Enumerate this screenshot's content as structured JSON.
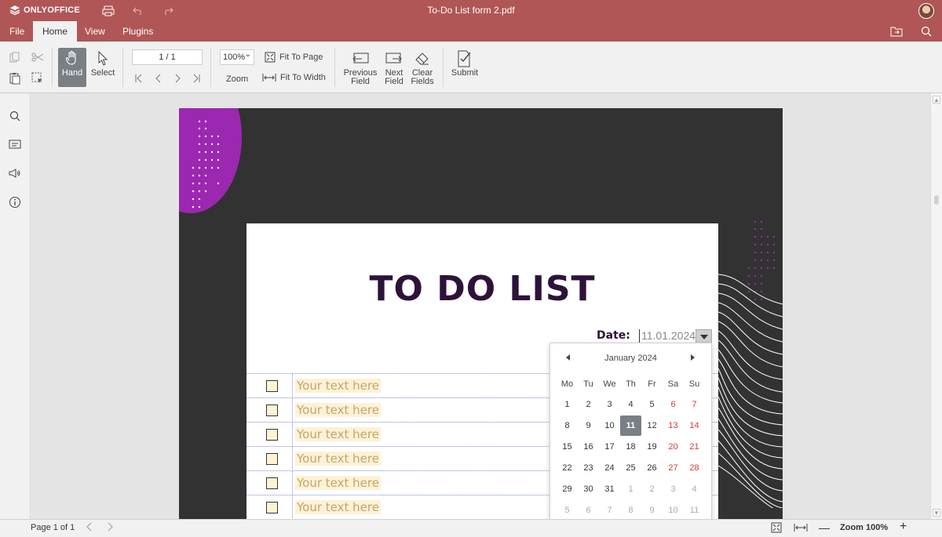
{
  "app": {
    "brand": "ONLYOFFICE",
    "doc_title": "To-Do List form 2.pdf"
  },
  "menu": {
    "tabs": [
      {
        "label": "File"
      },
      {
        "label": "Home"
      },
      {
        "label": "View"
      },
      {
        "label": "Plugins"
      }
    ],
    "active": "Home"
  },
  "toolbar": {
    "hand_label": "Hand",
    "select_label": "Select",
    "page_value": "1 / 1",
    "zoom_value": "100%",
    "zoom_label": "Zoom",
    "fit_page_label": "Fit To Page",
    "fit_width_label": "Fit To Width",
    "prev_field_label": [
      "Previous",
      "Field"
    ],
    "next_field_label": [
      "Next",
      "Field"
    ],
    "clear_fields_label": [
      "Clear",
      "Fields"
    ],
    "submit_label": "Submit"
  },
  "document": {
    "heading": "TO DO LIST",
    "date_label": "Date:",
    "date_value": "11.01.2024",
    "placeholder": "Your text here",
    "row_count_note": "",
    "rows": [
      "Your text here",
      "Your text here",
      "Your text here",
      "Your text here",
      "Your text here",
      "Your text here"
    ]
  },
  "calendar": {
    "month_label": "January 2024",
    "weekdays": [
      "Mo",
      "Tu",
      "We",
      "Th",
      "Fr",
      "Sa",
      "Su"
    ],
    "weeks": [
      [
        "1",
        "2",
        "3",
        "4",
        "5",
        "6",
        "7"
      ],
      [
        "8",
        "9",
        "10",
        "11",
        "12",
        "13",
        "14"
      ],
      [
        "15",
        "16",
        "17",
        "18",
        "19",
        "20",
        "21"
      ],
      [
        "22",
        "23",
        "24",
        "25",
        "26",
        "27",
        "28"
      ],
      [
        "29",
        "30",
        "31",
        "1",
        "2",
        "3",
        "4"
      ],
      [
        "5",
        "6",
        "7",
        "8",
        "9",
        "10",
        "11"
      ]
    ],
    "selected": "11"
  },
  "status": {
    "page_label": "Page 1 of 1",
    "zoom_label": "Zoom 100%"
  },
  "colors": {
    "header": "#b05656",
    "purple": "#9c27b0",
    "heading": "#2d1239",
    "weekend": "#d93a3a"
  }
}
